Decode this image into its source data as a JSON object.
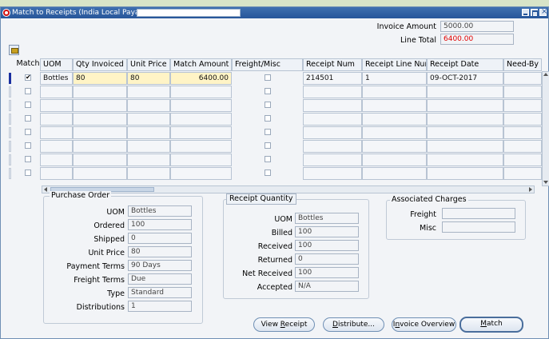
{
  "window": {
    "title": "Match to Receipts (India Local Payables)"
  },
  "header": {
    "invoice_amount_label": "Invoice Amount",
    "invoice_amount": "5000.00",
    "line_total_label": "Line Total",
    "line_total": "6400.00"
  },
  "grid": {
    "columns": {
      "match": "Match",
      "uom": "UOM",
      "qty_invoiced": "Qty Invoiced",
      "unit_price": "Unit Price",
      "match_amount": "Match Amount",
      "freight_misc": "Freight/Misc",
      "receipt_num": "Receipt Num",
      "receipt_line_num": "Receipt Line Num",
      "receipt_date": "Receipt Date",
      "need_by": "Need-By"
    },
    "row1": {
      "match": true,
      "uom": "Bottles",
      "qty_invoiced": "80",
      "unit_price": "80",
      "match_amount": "6400.00",
      "receipt_num": "214501",
      "receipt_line_num": "1",
      "receipt_date": "09-OCT-2017"
    }
  },
  "purchase_order": {
    "title": "Purchase Order",
    "uom_label": "UOM",
    "uom": "Bottles",
    "ordered_label": "Ordered",
    "ordered": "100",
    "shipped_label": "Shipped",
    "shipped": "0",
    "unit_price_label": "Unit Price",
    "unit_price": "80",
    "payment_terms_label": "Payment Terms",
    "payment_terms": "90 Days",
    "freight_terms_label": "Freight Terms",
    "freight_terms": "Due",
    "type_label": "Type",
    "type": "Standard",
    "distributions_label": "Distributions",
    "distributions": "1"
  },
  "receipt_quantity": {
    "title": "Receipt Quantity",
    "uom_label": "UOM",
    "uom": "Bottles",
    "billed_label": "Billed",
    "billed": "100",
    "received_label": "Received",
    "received": "100",
    "returned_label": "Returned",
    "returned": "0",
    "net_received_label": "Net Received",
    "net_received": "100",
    "accepted_label": "Accepted",
    "accepted": "N/A"
  },
  "associated_charges": {
    "title": "Associated Charges",
    "freight_label": "Freight",
    "freight": "",
    "misc_label": "Misc",
    "misc": ""
  },
  "buttons": {
    "view_receipt_pre": "View ",
    "view_receipt_ul": "R",
    "view_receipt_post": "eceipt",
    "distribute_ul": "D",
    "distribute_post": "istribute...",
    "invoice_overview_pre": "I",
    "invoice_overview_ul": "n",
    "invoice_overview_post": "voice Overview",
    "match_ul": "M",
    "match_post": "atch"
  },
  "colors": {
    "title_bar": "#27569a",
    "required_field": "#fff4c6",
    "line_total_text": "#e00000",
    "current_row_indicator": "#1a2fa0"
  }
}
